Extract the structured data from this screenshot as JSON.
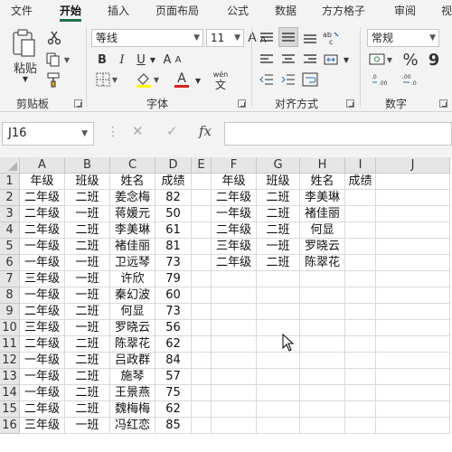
{
  "tabs": [
    "文件",
    "开始",
    "插入",
    "页面布局",
    "公式",
    "数据",
    "方方格子",
    "审阅",
    "视"
  ],
  "active_tab": "开始",
  "ribbon": {
    "clipboard": {
      "paste_label": "粘贴",
      "group_label": "剪贴板"
    },
    "font": {
      "font_name": "等线",
      "font_size": "11",
      "grow_icon": "A",
      "shrink_icon": "A",
      "bold": "B",
      "italic": "I",
      "underline": "U",
      "font_color_letter": "A",
      "wen": "wén",
      "wen_char": "文",
      "group_label": "字体"
    },
    "alignment": {
      "group_label": "对齐方式"
    },
    "number": {
      "format": "常规",
      "percent": "%",
      "comma": "9",
      "group_label": "数字"
    }
  },
  "formula_bar": {
    "name_box": "J16",
    "fx": "fx",
    "formula": ""
  },
  "sheet": {
    "columns": [
      "A",
      "B",
      "C",
      "D",
      "E",
      "F",
      "G",
      "H",
      "I",
      "J"
    ],
    "rows": [
      "1",
      "2",
      "3",
      "4",
      "5",
      "6",
      "7",
      "8",
      "9",
      "10",
      "11",
      "12",
      "13",
      "14",
      "15",
      "16"
    ],
    "cells": [
      [
        "年级",
        "班级",
        "姓名",
        "成绩",
        "",
        "年级",
        "班级",
        "姓名",
        "成绩",
        ""
      ],
      [
        "二年级",
        "二班",
        "姜念梅",
        "82",
        "",
        "二年级",
        "二班",
        "李美琳",
        "",
        ""
      ],
      [
        "二年级",
        "一班",
        "蒋媛元",
        "50",
        "",
        "一年级",
        "二班",
        "褚佳丽",
        "",
        ""
      ],
      [
        "二年级",
        "二班",
        "李美琳",
        "61",
        "",
        "二年级",
        "二班",
        "何显",
        "",
        ""
      ],
      [
        "一年级",
        "二班",
        "褚佳丽",
        "81",
        "",
        "三年级",
        "一班",
        "罗晓云",
        "",
        ""
      ],
      [
        "一年级",
        "一班",
        "卫远琴",
        "73",
        "",
        "二年级",
        "二班",
        "陈翠花",
        "",
        ""
      ],
      [
        "三年级",
        "一班",
        "许欣",
        "79",
        "",
        "",
        "",
        "",
        "",
        ""
      ],
      [
        "一年级",
        "一班",
        "秦幻波",
        "60",
        "",
        "",
        "",
        "",
        "",
        ""
      ],
      [
        "二年级",
        "二班",
        "何显",
        "73",
        "",
        "",
        "",
        "",
        "",
        ""
      ],
      [
        "三年级",
        "一班",
        "罗晓云",
        "56",
        "",
        "",
        "",
        "",
        "",
        ""
      ],
      [
        "二年级",
        "二班",
        "陈翠花",
        "62",
        "",
        "",
        "",
        "",
        "",
        ""
      ],
      [
        "一年级",
        "二班",
        "吕政群",
        "84",
        "",
        "",
        "",
        "",
        "",
        ""
      ],
      [
        "一年级",
        "二班",
        "施琴",
        "57",
        "",
        "",
        "",
        "",
        "",
        ""
      ],
      [
        "一年级",
        "二班",
        "王景燕",
        "75",
        "",
        "",
        "",
        "",
        "",
        ""
      ],
      [
        "二年级",
        "二班",
        "魏梅梅",
        "62",
        "",
        "",
        "",
        "",
        "",
        ""
      ],
      [
        "三年级",
        "一班",
        "冯红恋",
        "85",
        "",
        "",
        "",
        "",
        "",
        ""
      ]
    ]
  },
  "colors": {
    "accent": "#217346",
    "font_color": "#e02020",
    "highlight": "#ffff00"
  }
}
